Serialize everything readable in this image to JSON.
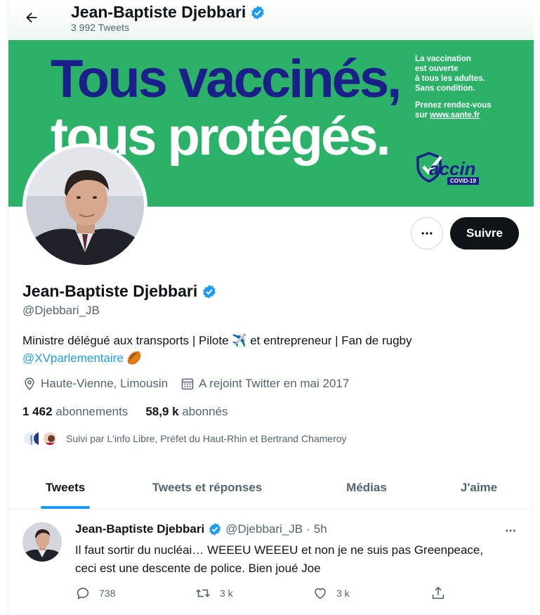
{
  "header": {
    "name": "Jean-Baptiste Djebbari",
    "tweet_count": "3 992 Tweets",
    "back_icon": "arrow-left-icon",
    "verified_icon": "verified-badge-icon"
  },
  "banner": {
    "slogan_line1": "Tous vaccinés,",
    "slogan_line2": "tous protégés.",
    "side_line1": "La vaccination",
    "side_line2": "est ouverte",
    "side_line3": "à tous les adultes.",
    "side_line4": "Sans condition.",
    "side_line5": "Prenez rendez-vous",
    "side_line6_prefix": "sur ",
    "side_url": "www.sante.fr",
    "logo_word": "accin",
    "logo_tag": "COVID-19",
    "background_color": "#2bb168",
    "slogan_color": "#1b1f8a"
  },
  "actions": {
    "follow_label": "Suivre",
    "more_icon": "more-horizontal-icon"
  },
  "profile": {
    "name": "Jean-Baptiste Djebbari",
    "handle": "@Djebbari_JB",
    "bio_text": "Ministre délégué aux transports | Pilote ",
    "bio_plane": "✈️",
    "bio_text2": " et entrepreneur | Fan de rugby",
    "bio_link": "@XVparlementaire",
    "bio_ball": "🏉",
    "location": "Haute-Vienne, Limousin",
    "joined": "A rejoint Twitter en mai 2017",
    "following_count": "1 462",
    "following_label": "abonnements",
    "followers_count": "58,9 k",
    "followers_label": "abonnés",
    "followed_by": "Suivi par L'info Libre, Préfet du Haut-Rhin et Bertrand Chameroy"
  },
  "tabs": [
    {
      "label": "Tweets",
      "active": true
    },
    {
      "label": "Tweets et réponses",
      "active": false
    },
    {
      "label": "Médias",
      "active": false
    },
    {
      "label": "J'aime",
      "active": false
    }
  ],
  "tweet": {
    "name": "Jean-Baptiste Djebbari",
    "handle": "@Djebbari_JB",
    "dot": "·",
    "time": "5h",
    "text_line1": "Il faut sortir du nucléai… WEEEU WEEEU et non je ne suis pas Greenpeace,",
    "text_line2": "ceci est une descente de police. Bien joué Joe",
    "replies": "738",
    "retweets": "3 k",
    "likes": "3 k"
  },
  "colors": {
    "accent": "#1d9bf0",
    "text": "#0f1419",
    "secondary": "#536471"
  }
}
